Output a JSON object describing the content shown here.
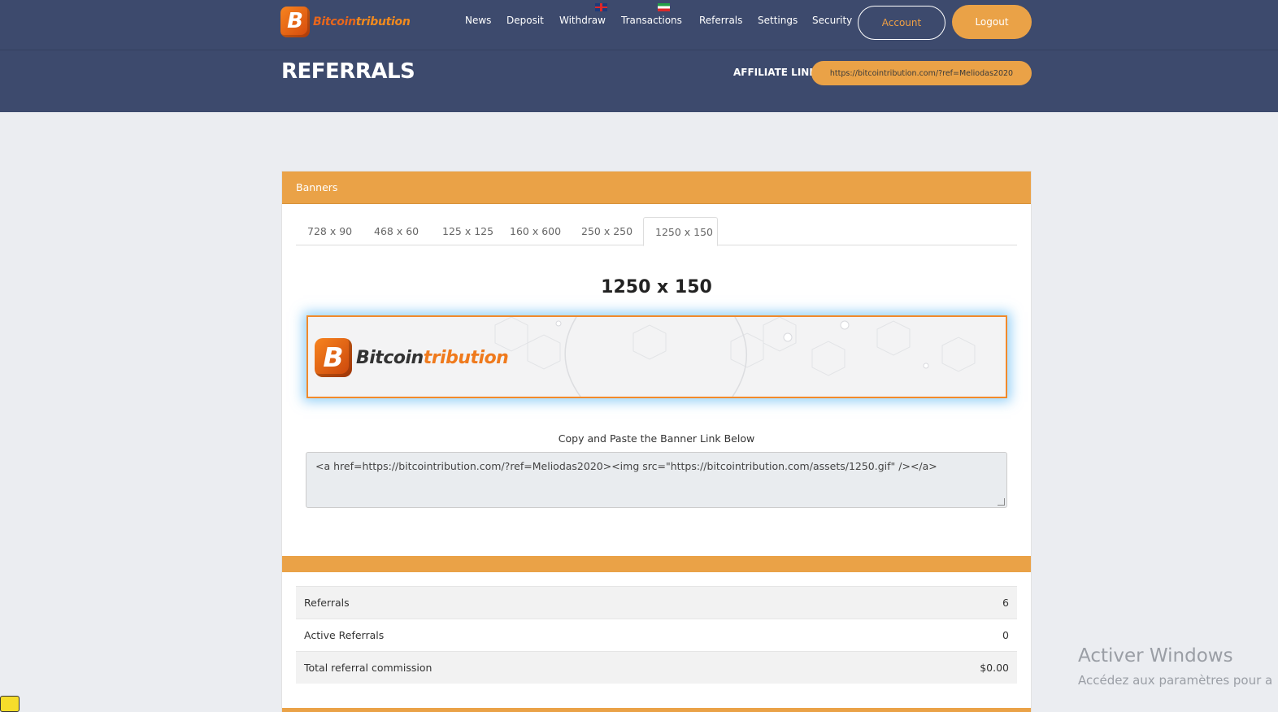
{
  "brand": {
    "name_part1": "Bitcoin",
    "name_part2": "tribution",
    "mark": "B"
  },
  "nav": {
    "items": [
      "News",
      "Deposit",
      "Withdraw",
      "Transactions",
      "Referrals",
      "Settings",
      "Security"
    ],
    "account_label": "Account",
    "logout_label": "Logout"
  },
  "header": {
    "title": "REFERRALS",
    "affiliate_label": "AFFILIATE LINK:",
    "affiliate_link": "https://bitcointribution.com/?ref=Meliodas2020"
  },
  "banners": {
    "panel_title": "Banners",
    "tabs": [
      "728 x 90",
      "468 x 60",
      "125 x 125",
      "160 x 600",
      "250 x 250",
      "1250 x 150"
    ],
    "active_tab": "1250 x 150",
    "selected_title": "1250 x 150",
    "copy_label": "Copy and Paste the Banner Link Below",
    "code": "<a href=https://bitcointribution.com/?ref=Meliodas2020><img src=\"https://bitcointribution.com/assets/1250.gif\" /></a>"
  },
  "stats": {
    "rows": [
      {
        "label": "Referrals",
        "value": "6"
      },
      {
        "label": "Active Referrals",
        "value": "0"
      },
      {
        "label": "Total referral commission",
        "value": "$0.00"
      }
    ]
  },
  "watermark": {
    "line1": "Activer Windows",
    "line2": "Accédez aux paramètres pour a"
  },
  "colors": {
    "header_bg": "#3d4a6d",
    "accent": "#eaa247",
    "page_bg": "#ebedf1",
    "banner_border": "#f28a2a",
    "brand_orange": "#ef7a1d"
  }
}
